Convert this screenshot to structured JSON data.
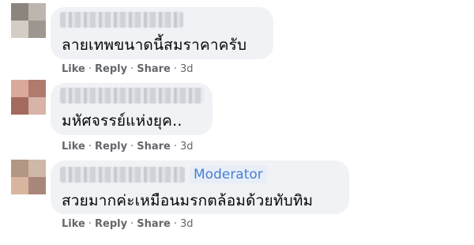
{
  "comments": [
    {
      "text": "ลายเทพขนาดนี้สมราคาครับ",
      "actions": {
        "like": "Like",
        "reply": "Reply",
        "share": "Share",
        "time": "3d"
      }
    },
    {
      "text": "มหัศจรรย์แห่งยุค..",
      "actions": {
        "like": "Like",
        "reply": "Reply",
        "share": "Share",
        "time": "3d"
      }
    },
    {
      "badge": "Moderator",
      "text": "สวยมากค่ะเหมือนมรกตล้อมด้วยทับทิม",
      "actions": {
        "like": "Like",
        "reply": "Reply",
        "share": "Share",
        "time": "3d"
      }
    }
  ],
  "separator": "·",
  "colors": {
    "bubble": "#f0f2f5",
    "action_text": "#65676b",
    "moderator_badge": "#4a7fcf"
  }
}
